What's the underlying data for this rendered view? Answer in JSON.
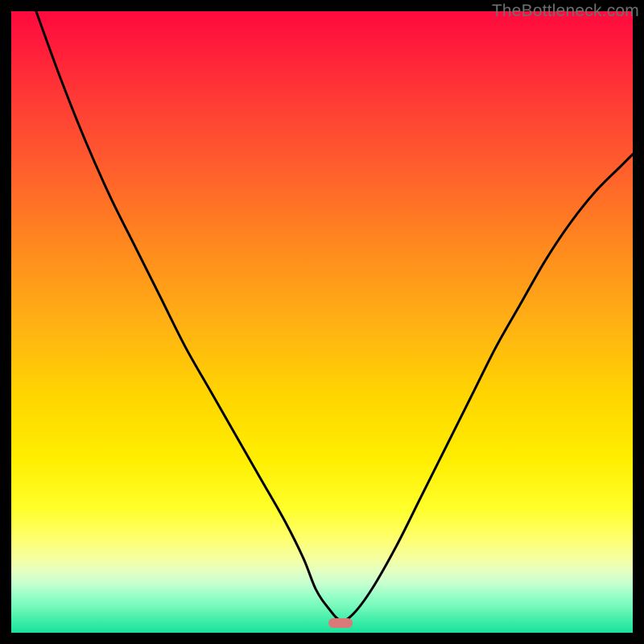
{
  "watermark": "TheBottleneck.com",
  "marker": {
    "x_pct": 53.0,
    "y_pct": 98.4
  },
  "chart_data": {
    "type": "line",
    "title": "",
    "xlabel": "",
    "ylabel": "",
    "xlim": [
      0,
      100
    ],
    "ylim": [
      0,
      100
    ],
    "series": [
      {
        "name": "bottleneck-curve",
        "x": [
          4,
          8,
          12,
          16,
          20,
          24,
          28,
          32,
          36,
          40,
          44,
          47,
          49,
          51,
          53,
          55,
          58,
          62,
          66,
          70,
          74,
          78,
          82,
          86,
          90,
          94,
          98,
          100
        ],
        "y": [
          100,
          89,
          79,
          70,
          62,
          54,
          46,
          39,
          32,
          25,
          18,
          12,
          7,
          4,
          2,
          3,
          7,
          14,
          22,
          30,
          38,
          46,
          53,
          60,
          66,
          71,
          75,
          77
        ]
      }
    ],
    "gradient_stops": [
      {
        "pct": 0,
        "color": "#ff0a3e"
      },
      {
        "pct": 14,
        "color": "#ff3a35"
      },
      {
        "pct": 36,
        "color": "#ff8320"
      },
      {
        "pct": 62,
        "color": "#ffd600"
      },
      {
        "pct": 85,
        "color": "#ffff70"
      },
      {
        "pct": 100,
        "color": "#18e39a"
      }
    ]
  }
}
